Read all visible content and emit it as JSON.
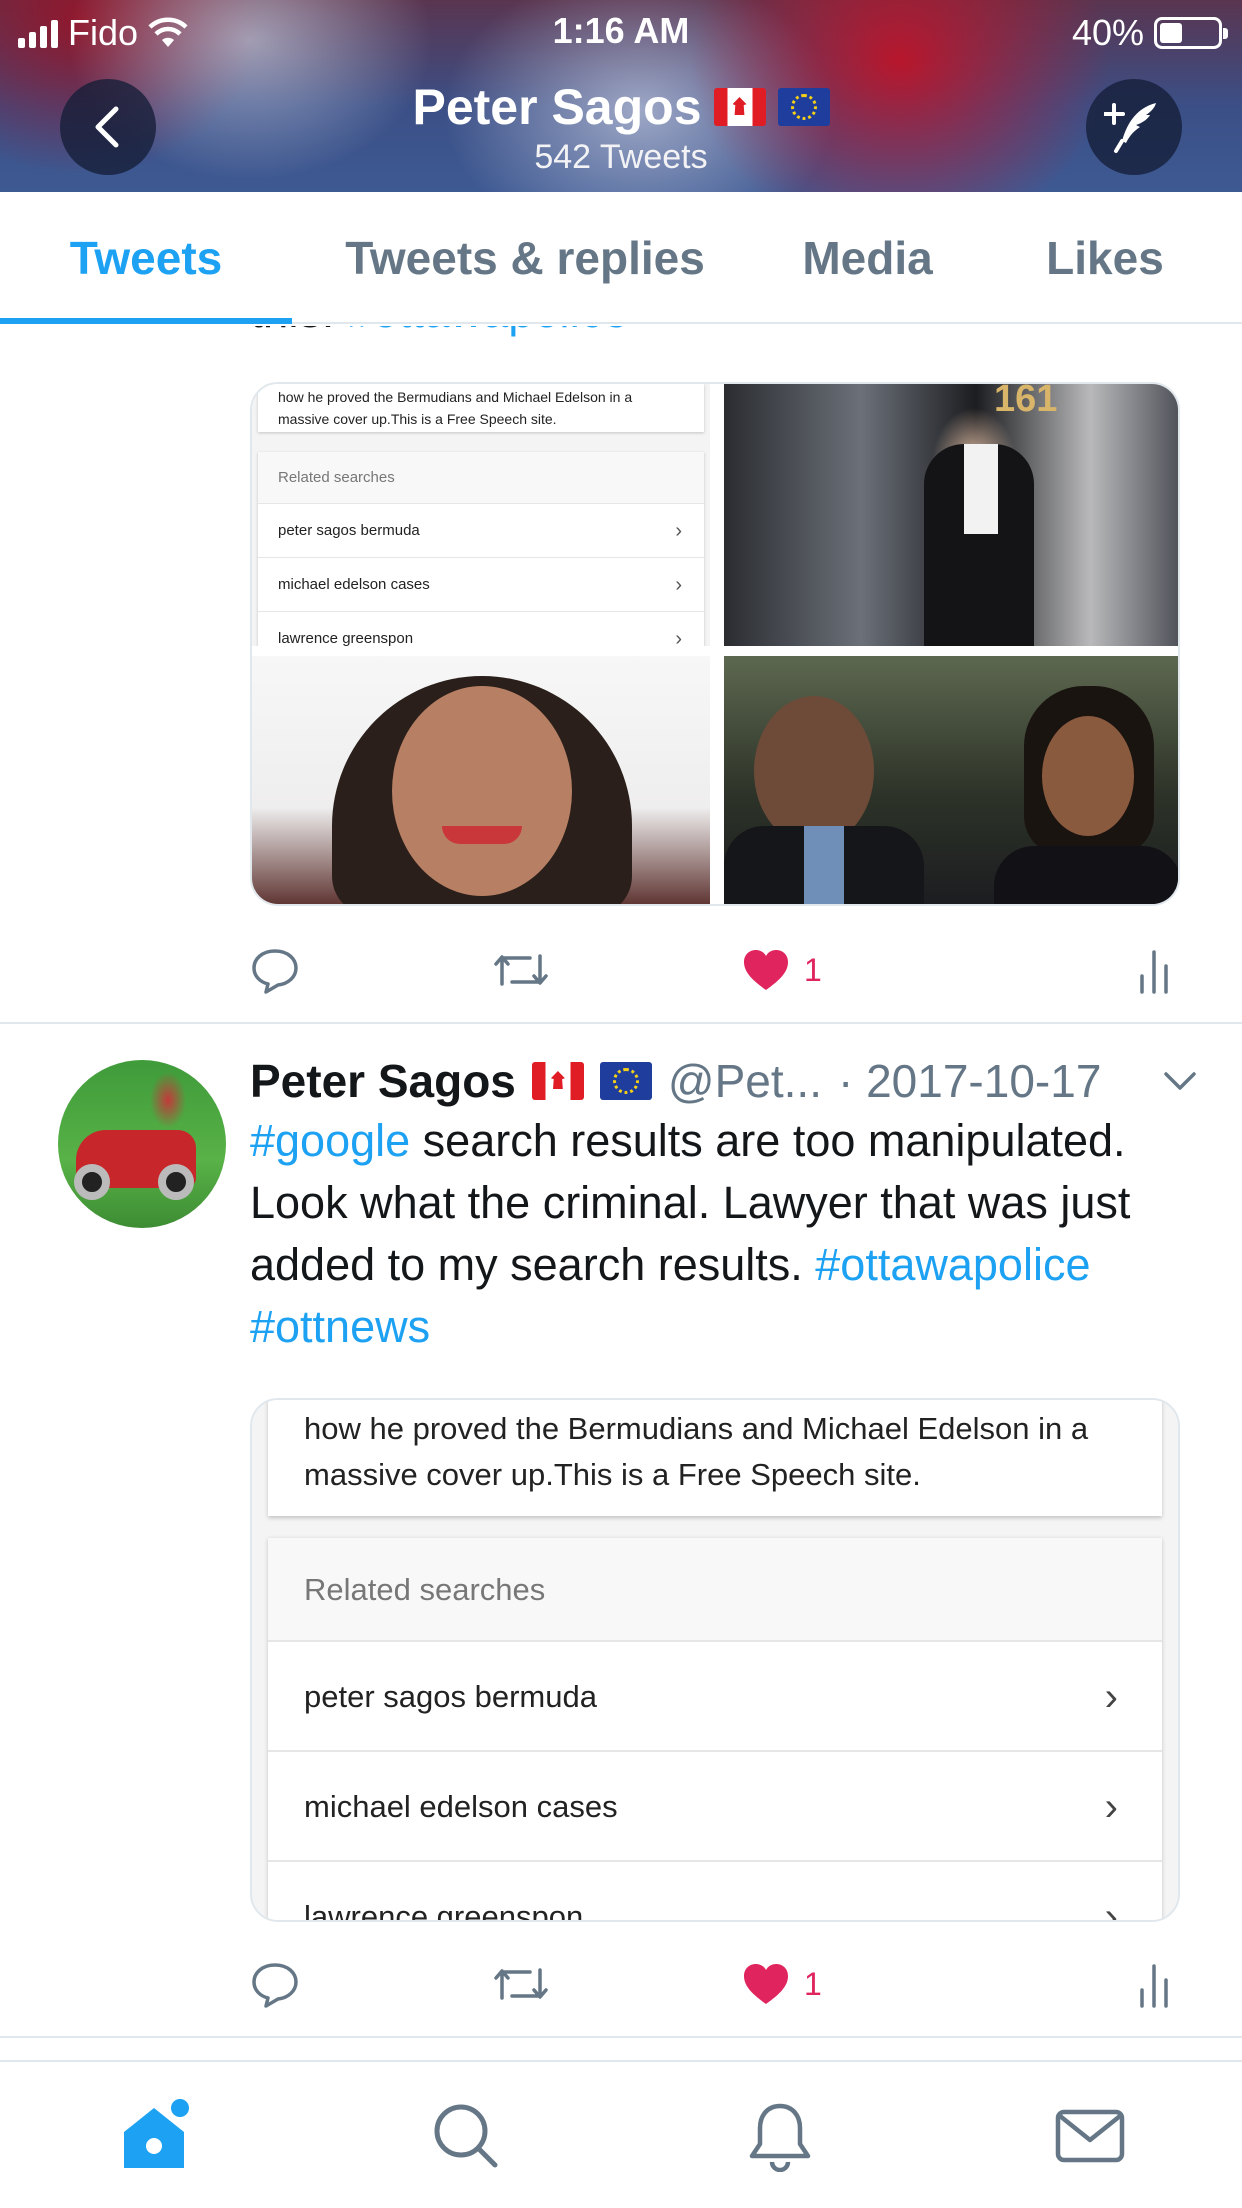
{
  "status_bar": {
    "carrier": "Fido",
    "time": "1:16 AM",
    "battery_percent": "40%",
    "battery_level": 0.4
  },
  "header": {
    "name": "Peter Sagos",
    "flags": [
      "canada-flag",
      "eu-flag"
    ],
    "tweet_count": "542 Tweets",
    "back_icon": "chevron-left-icon",
    "compose_icon": "compose-tweet-icon"
  },
  "tabs": [
    {
      "label": "Tweets",
      "active": true
    },
    {
      "label": "Tweets & replies",
      "active": false
    },
    {
      "label": "Media",
      "active": false
    },
    {
      "label": "Likes",
      "active": false
    }
  ],
  "tweet1": {
    "cut_text_prefix": "this.",
    "cut_hashtag": "#ottawapolice",
    "screenshot": {
      "snippet": "how he proved the Bermudians and Michael Edelson in a massive cover up.This is a Free Speech site.",
      "related_header": "Related searches",
      "related_items": [
        "peter sagos bermuda",
        "michael edelson cases",
        "lawrence greenspon"
      ]
    },
    "building_number": "161",
    "likes": "1"
  },
  "tweet2": {
    "name": "Peter Sagos",
    "handle": "@Pet...",
    "date": "· 2017-10-17",
    "text_parts": {
      "hashtag_google": "#google",
      "body": " search results are too manipulated. Look what the criminal. Lawyer that was just added to my search results. ",
      "hashtag_ottawapolice": "#ottawapolice",
      "space": " ",
      "hashtag_ottnews": "#ottnews"
    },
    "card": {
      "snippet": "how he proved the Bermudians and Michael Edelson in a massive cover up.This is a Free Speech site.",
      "related_header": "Related searches",
      "related_items": [
        "peter sagos bermuda",
        "michael edelson cases",
        "lawrence greenspon"
      ]
    },
    "likes": "1"
  },
  "bottom_nav": [
    "home-icon",
    "search-icon",
    "notifications-icon",
    "messages-icon"
  ],
  "colors": {
    "accent": "#1da1f2",
    "like": "#e0245e",
    "secondary_text": "#657786",
    "divider": "#e1e8ed"
  }
}
